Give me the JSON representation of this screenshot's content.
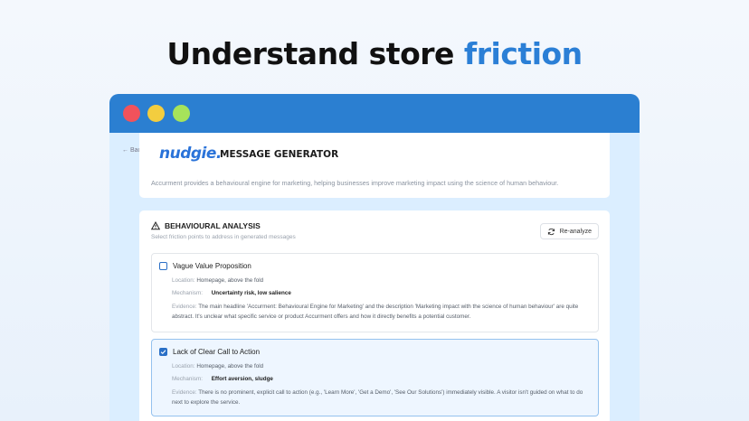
{
  "headline": {
    "main": "Understand store",
    "accent": "friction"
  },
  "window": {
    "colors": {
      "red": "#f2525b",
      "yellow": "#f3cd3f",
      "green": "#a6e35b",
      "titlebar": "#2b7fd1"
    }
  },
  "nav": {
    "back_label": "← Back"
  },
  "header": {
    "logo": "nudgie.",
    "title": "MESSAGE GENERATOR",
    "description": "Accurment provides a behavioural engine for marketing, helping businesses improve marketing impact using the science of human behaviour."
  },
  "analysis": {
    "title": "BEHAVIOURAL ANALYSIS",
    "subtitle": "Select friction points to address in generated messages",
    "reanalyze_label": "Re-analyze",
    "items": [
      {
        "title": "Vague Value Proposition",
        "checked": false,
        "location_label": "Location:",
        "location": "Homepage, above the fold",
        "mechanism_label": "Mechanism:",
        "mechanism": "Uncertainty risk, low salience",
        "evidence_label": "Evidence:",
        "evidence": "The main headline 'Accurment: Behavioural Engine for Marketing' and the description 'Marketing impact with the science of human behaviour' are quite abstract. It's unclear what specific service or product Accurment offers and how it directly benefits a potential customer."
      },
      {
        "title": "Lack of Clear Call to Action",
        "checked": true,
        "location_label": "Location:",
        "location": "Homepage, above the fold",
        "mechanism_label": "Mechanism:",
        "mechanism": "Effort aversion, sludge",
        "evidence_label": "Evidence:",
        "evidence": "There is no prominent, explicit call to action (e.g., 'Learn More', 'Get a Demo', 'See Our Solutions') immediately visible. A visitor isn't guided on what to do next to explore the service."
      }
    ]
  }
}
